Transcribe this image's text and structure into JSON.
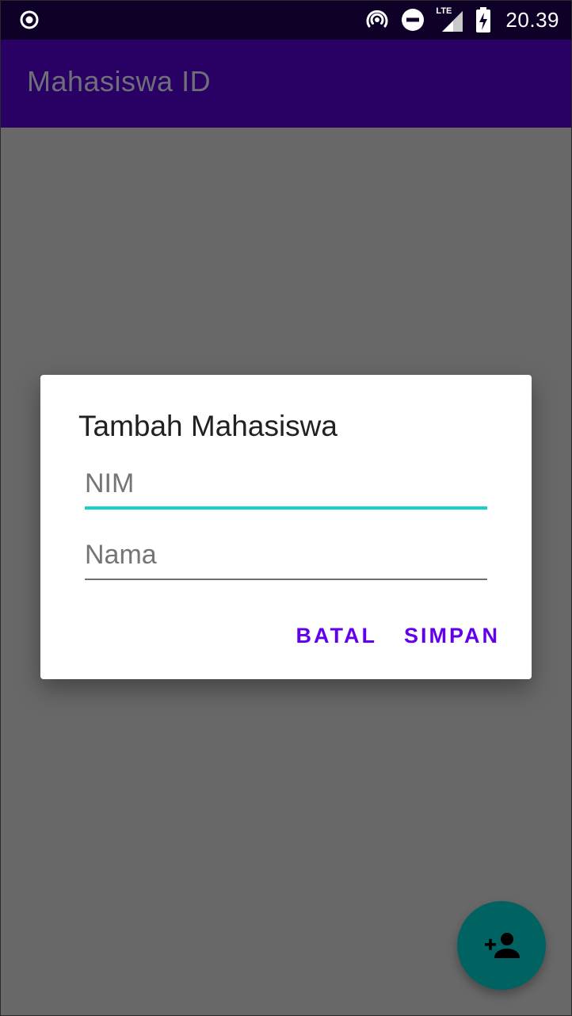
{
  "status_bar": {
    "time": "20.39",
    "network_label": "LTE",
    "icons": [
      "record-icon",
      "hotspot-icon",
      "dnd-icon",
      "signal-icon",
      "battery-charging-icon"
    ]
  },
  "app_bar": {
    "title": "Mahasiswa ID"
  },
  "dialog": {
    "title": "Tambah Mahasiswa",
    "nim_placeholder": "NIM",
    "nama_placeholder": "Nama",
    "cancel_label": "BATAL",
    "save_label": "SIMPAN"
  },
  "fab": {
    "icon": "add-person-icon"
  },
  "colors": {
    "status_bar": "#0f0028",
    "app_bar": "#290063",
    "scrim_background": "#686868",
    "accent_underline": "#17d0c6",
    "button_text": "#6200ee",
    "fab": "#006261"
  }
}
